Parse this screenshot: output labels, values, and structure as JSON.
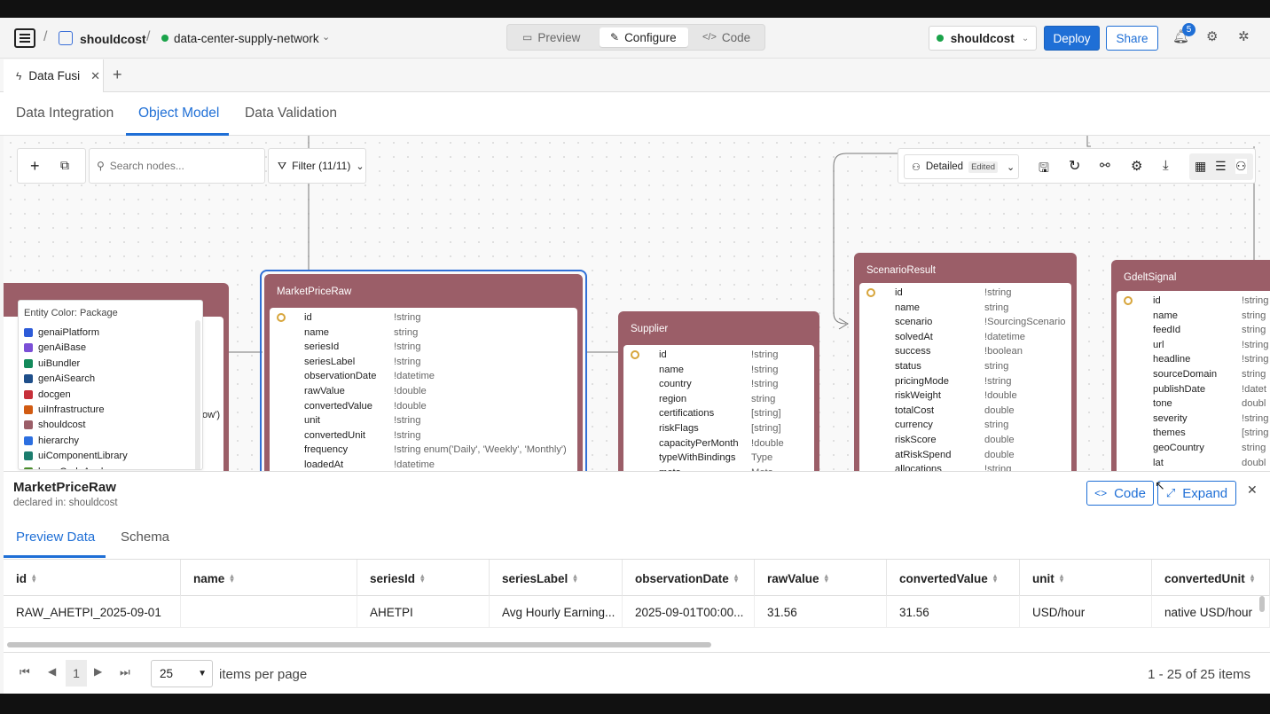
{
  "header": {
    "workspace": "shouldcost",
    "project": "data-center-supply-network",
    "modes": [
      "Preview",
      "Configure",
      "Code"
    ],
    "active_mode": "Configure",
    "env_select": "shouldcost",
    "deploy_label": "Deploy",
    "share_label": "Share",
    "notification_count": "5"
  },
  "doc_tabs": {
    "active_label": "Data Fusi"
  },
  "subtabs": [
    "Data Integration",
    "Object Model",
    "Data Validation"
  ],
  "toolbar": {
    "search_placeholder": "Search nodes...",
    "filter_label": "Filter (11/11)",
    "view_label": "Detailed",
    "view_badge": "Edited"
  },
  "legend": {
    "title": "Entity Color: Package",
    "items": [
      {
        "label": "genaiPlatform",
        "color": "#2d5bd8"
      },
      {
        "label": "genAiBase",
        "color": "#7b4fd6"
      },
      {
        "label": "uiBundler",
        "color": "#138a5b"
      },
      {
        "label": "genAiSearch",
        "color": "#1f4f8a"
      },
      {
        "label": "docgen",
        "color": "#c7303a"
      },
      {
        "label": "uiInfrastructure",
        "color": "#d15b12"
      },
      {
        "label": "shouldcost",
        "color": "#9b5e68"
      },
      {
        "label": "hierarchy",
        "color": "#2c6fe0"
      },
      {
        "label": "uiComponentLibrary",
        "color": "#1c7d6e"
      },
      {
        "label": "baseCodeAnalyzer",
        "color": "#4a8c2a"
      }
    ]
  },
  "canvas": {
    "partial_text": "ow')",
    "nodes": {
      "marketPriceRaw": {
        "title": "MarketPriceRaw",
        "fields": [
          {
            "name": "id",
            "type": "!string"
          },
          {
            "name": "name",
            "type": "string"
          },
          {
            "name": "seriesId",
            "type": "!string"
          },
          {
            "name": "seriesLabel",
            "type": "!string"
          },
          {
            "name": "observationDate",
            "type": "!datetime"
          },
          {
            "name": "rawValue",
            "type": "!double"
          },
          {
            "name": "convertedValue",
            "type": "!double"
          },
          {
            "name": "unit",
            "type": "!string"
          },
          {
            "name": "convertedUnit",
            "type": "!string"
          },
          {
            "name": "frequency",
            "type": "!string enum('Daily', 'Weekly', 'Monthly')"
          },
          {
            "name": "loadedAt",
            "type": "!datetime"
          }
        ]
      },
      "supplier": {
        "title": "Supplier",
        "fields": [
          {
            "name": "id",
            "type": "!string"
          },
          {
            "name": "name",
            "type": "!string"
          },
          {
            "name": "country",
            "type": "!string"
          },
          {
            "name": "region",
            "type": "string"
          },
          {
            "name": "certifications",
            "type": "[string]"
          },
          {
            "name": "riskFlags",
            "type": "[string]"
          },
          {
            "name": "capacityPerMonth",
            "type": "!double"
          },
          {
            "name": "typeWithBindings",
            "type": "Type"
          },
          {
            "name": "meta",
            "type": "Meta"
          }
        ]
      },
      "scenarioResult": {
        "title": "ScenarioResult",
        "fields": [
          {
            "name": "id",
            "type": "!string"
          },
          {
            "name": "name",
            "type": "string"
          },
          {
            "name": "scenario",
            "type": "!SourcingScenario"
          },
          {
            "name": "solvedAt",
            "type": "!datetime"
          },
          {
            "name": "success",
            "type": "!boolean"
          },
          {
            "name": "status",
            "type": "string"
          },
          {
            "name": "pricingMode",
            "type": "!string"
          },
          {
            "name": "riskWeight",
            "type": "!double"
          },
          {
            "name": "totalCost",
            "type": "double"
          },
          {
            "name": "currency",
            "type": "string"
          },
          {
            "name": "riskScore",
            "type": "double"
          },
          {
            "name": "atRiskSpend",
            "type": "double"
          },
          {
            "name": "allocations",
            "type": "!string"
          }
        ]
      },
      "gdeltSignal": {
        "title": "GdeltSignal",
        "fields": [
          {
            "name": "id",
            "type": "!string"
          },
          {
            "name": "name",
            "type": "string"
          },
          {
            "name": "feedId",
            "type": "string"
          },
          {
            "name": "url",
            "type": "!string"
          },
          {
            "name": "headline",
            "type": "!string"
          },
          {
            "name": "sourceDomain",
            "type": "string"
          },
          {
            "name": "publishDate",
            "type": "!datet"
          },
          {
            "name": "tone",
            "type": "doubl"
          },
          {
            "name": "severity",
            "type": "!string"
          },
          {
            "name": "themes",
            "type": "[string"
          },
          {
            "name": "geoCountry",
            "type": "string"
          },
          {
            "name": "lat",
            "type": "doubl"
          }
        ]
      }
    }
  },
  "details": {
    "title": "MarketPriceRaw",
    "declared": "declared in: shouldcost",
    "code_label": "Code",
    "expand_label": "Expand",
    "tabs": [
      "Preview Data",
      "Schema"
    ],
    "columns": [
      "id",
      "name",
      "seriesId",
      "seriesLabel",
      "observationDate",
      "rawValue",
      "convertedValue",
      "unit",
      "convertedUnit"
    ],
    "rows": [
      [
        "RAW_AHETPI_2025-09-01",
        "",
        "AHETPI",
        "Avg Hourly Earning...",
        "2025-09-01T00:00...",
        "31.56",
        "31.56",
        "USD/hour",
        "native USD/hour"
      ]
    ],
    "pager": {
      "page": "1",
      "page_size": "25",
      "per_page_label": "items per page",
      "summary": "1 - 25 of 25 items"
    }
  }
}
